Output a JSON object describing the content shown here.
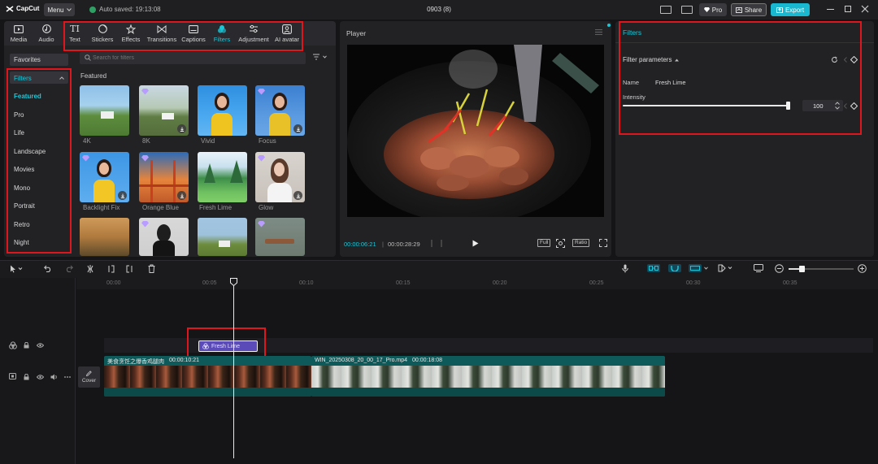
{
  "app": {
    "logo_text": "CapCut",
    "menu_label": "Menu",
    "autosave_text": "Auto saved: 19:13:08",
    "project_title": "0903 (8)",
    "pro_label": "Pro",
    "share_label": "Share",
    "export_label": "Export"
  },
  "media_tabs": [
    {
      "label": "Media",
      "icon": "media-icon"
    },
    {
      "label": "Audio",
      "icon": "audio-icon"
    },
    {
      "label": "Text",
      "icon": "text-icon"
    },
    {
      "label": "Stickers",
      "icon": "stickers-icon"
    },
    {
      "label": "Effects",
      "icon": "effects-icon"
    },
    {
      "label": "Transitions",
      "icon": "transitions-icon"
    },
    {
      "label": "Captions",
      "icon": "captions-icon"
    },
    {
      "label": "Filters",
      "icon": "filters-icon",
      "active": true
    },
    {
      "label": "Adjustment",
      "icon": "adjustment-icon"
    },
    {
      "label": "AI avatar",
      "icon": "ai-avatar-icon"
    }
  ],
  "sidebar": {
    "favorites": "Favorites",
    "filters_header": "Filters",
    "items": [
      "Featured",
      "Pro",
      "Life",
      "Landscape",
      "Movies",
      "Mono",
      "Portrait",
      "Retro",
      "Night"
    ]
  },
  "filters_panel": {
    "search_placeholder": "Search for filters",
    "section_title": "Featured",
    "cards": [
      {
        "label": "4K"
      },
      {
        "label": "8K"
      },
      {
        "label": "Vivid"
      },
      {
        "label": "Focus"
      },
      {
        "label": "Backlight Fix"
      },
      {
        "label": "Orange Blue"
      },
      {
        "label": "Fresh Lime"
      },
      {
        "label": "Glow"
      }
    ]
  },
  "player": {
    "title": "Player",
    "current_time": "00:00:06:21",
    "total_time": "00:00:28:29",
    "full_label": "Full",
    "ratio_label": "Ratio"
  },
  "properties": {
    "title": "Filters",
    "params_label": "Filter parameters",
    "name_label": "Name",
    "name_value": "Fresh Lime",
    "intensity_label": "Intensity",
    "intensity_value": "100",
    "intensity_fraction": 1.0
  },
  "timeline": {
    "ruler": [
      "00:00",
      "00:05",
      "00:10",
      "00:15",
      "00:20",
      "00:25",
      "00:30",
      "00:35"
    ],
    "filter_clip_label": "Fresh Lime",
    "cover_label": "Cover",
    "clip1_title": "美食烹饪之爆香鸡腿肉",
    "clip1_duration": "00:00:10:21",
    "clip2_title": "WIN_20250308_20_00_17_Pro.mp4",
    "clip2_duration": "00:00:18:08"
  },
  "colors": {
    "accent": "#19c8d8",
    "highlight_box": "#e0161e",
    "export_bg": "#19b8d0",
    "filter_clip": "#5a4bb8",
    "video_track": "#0e5a5a"
  }
}
